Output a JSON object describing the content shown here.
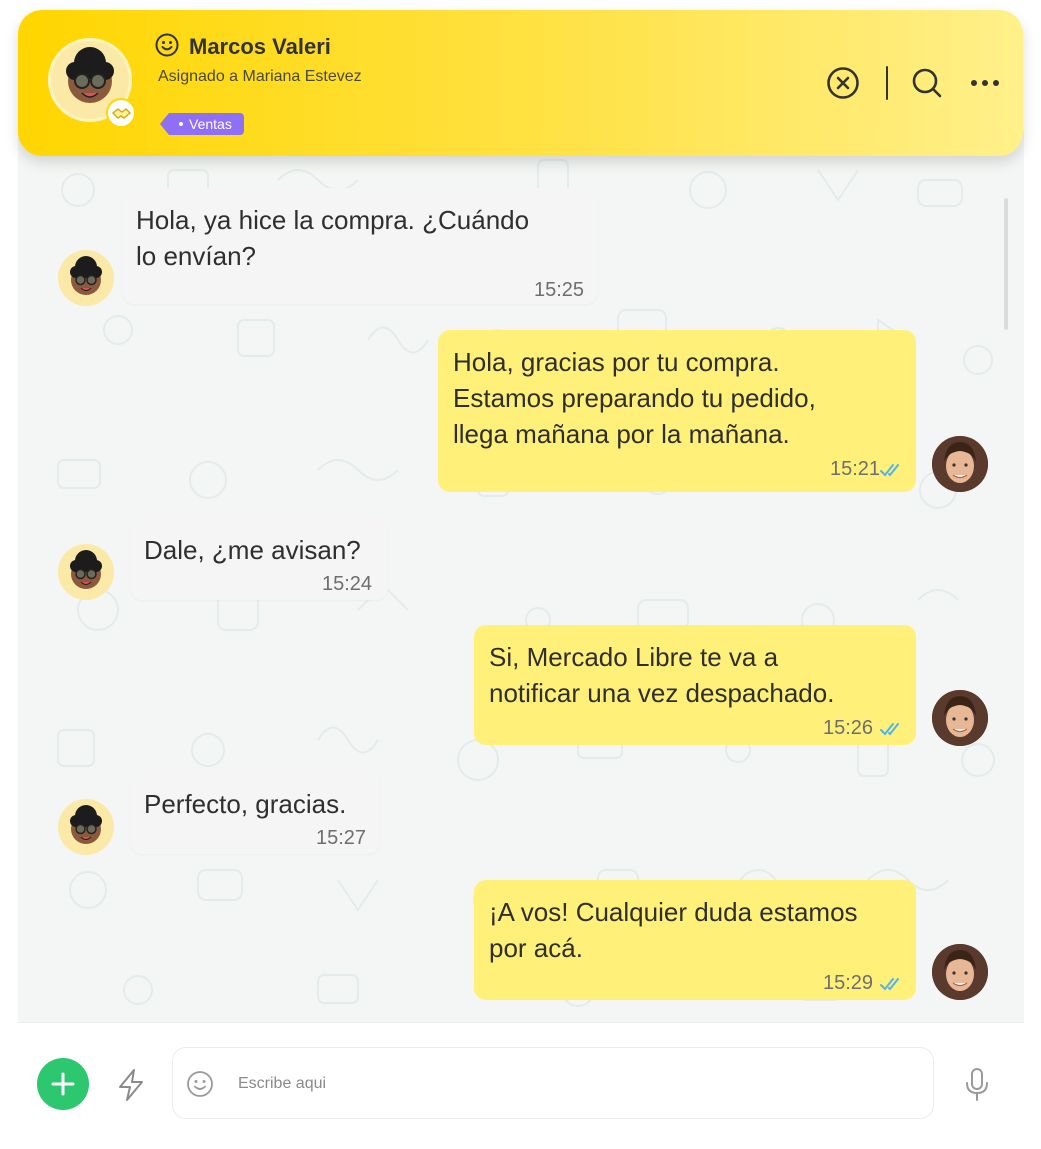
{
  "header": {
    "contact_name": "Marcos Valeri",
    "assigned_text": "Asignado a Mariana Estevez",
    "tag_label": "Ventas",
    "tag_color": "#8e6ff5",
    "bar_color": "#ffd600",
    "status_icon": "smiley-icon",
    "actions": [
      "close-circle-icon",
      "search-icon",
      "more-icon"
    ]
  },
  "messages": [
    {
      "direction": "in",
      "lines": [
        "Hola, ya hice la compra. ¿Cuándo",
        "lo envían?"
      ],
      "time": "15:25"
    },
    {
      "direction": "out",
      "lines": [
        "Hola, gracias por tu compra.",
        "Estamos preparando tu pedido,",
        "llega mañana por la mañana."
      ],
      "time": "15:21",
      "read": true
    },
    {
      "direction": "in",
      "lines": [
        "Dale, ¿me avisan?"
      ],
      "time": "15:24"
    },
    {
      "direction": "out",
      "lines": [
        "Si, Mercado Libre te va a",
        "notificar una vez despachado."
      ],
      "time": "15:26",
      "read": true
    },
    {
      "direction": "in",
      "lines": [
        "Perfecto, gracias."
      ],
      "time": "15:27"
    },
    {
      "direction": "out",
      "lines": [
        "¡A vos! Cualquier duda estamos",
        "por acá."
      ],
      "time": "15:29",
      "read": true
    }
  ],
  "composer": {
    "placeholder": "Escribe aqui",
    "add_icon": "plus-icon",
    "quick_reply_icon": "lightning-icon",
    "emoji_icon": "emoji-icon",
    "mic_icon": "microphone-icon",
    "add_color": "#2cc76f"
  },
  "colors": {
    "incoming_bubble": "#f5f5f5",
    "outgoing_bubble": "#fff07a",
    "read_check": "#4fb5ee"
  }
}
